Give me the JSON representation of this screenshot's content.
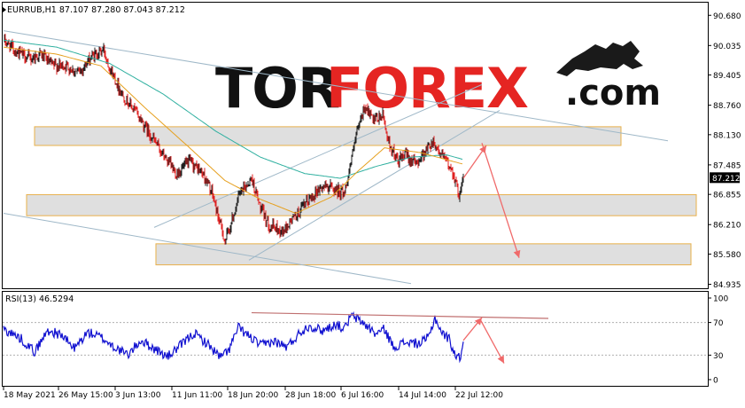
{
  "symbol_header": "EURRUB,H1  87.107 87.280 87.043 87.212",
  "watermark": {
    "part1": "TOR",
    "part2": "FOREX",
    "suffix": ".com"
  },
  "colors": {
    "bull": "#1f1f1f",
    "bear": "#e02020",
    "ma_fast": "#e6a01e",
    "ma_slow": "#30b0a0",
    "zone_fill": "#dcdcdc",
    "zone_border": "#e8b04a",
    "channel": "#9fb8c8",
    "arrow": "#f06a6a",
    "rsi": "#1010d0",
    "rsi_trend": "#c07070"
  },
  "chart_data": [
    {
      "type": "candlestick",
      "title": "EURRUB,H1",
      "ohlc_last": {
        "open": 87.107,
        "high": 87.28,
        "low": 87.043,
        "close": 87.212
      },
      "price_label": "87.212",
      "y_ticks": [
        "90.680",
        "90.035",
        "89.405",
        "88.760",
        "88.130",
        "87.485",
        "86.855",
        "86.210",
        "85.580",
        "84.935"
      ],
      "ylim": [
        84.85,
        90.95
      ],
      "x_ticks": [
        "18 May 2021",
        "26 May 15:00",
        "3 Jun 13:00",
        "11 Jun 11:00",
        "18 Jun 20:00",
        "28 Jun 18:00",
        "6 Jul 16:00",
        "14 Jul 14:00",
        "22 Jul 12:00"
      ],
      "close_anchors": [
        [
          0,
          90.15
        ],
        [
          15,
          89.9
        ],
        [
          30,
          89.75
        ],
        [
          42,
          89.85
        ],
        [
          55,
          89.6
        ],
        [
          70,
          89.6
        ],
        [
          85,
          89.45
        ],
        [
          100,
          89.8
        ],
        [
          113,
          89.95
        ],
        [
          120,
          89.55
        ],
        [
          135,
          88.95
        ],
        [
          150,
          88.6
        ],
        [
          165,
          88.15
        ],
        [
          180,
          87.7
        ],
        [
          195,
          87.3
        ],
        [
          210,
          87.55
        ],
        [
          225,
          87.3
        ],
        [
          235,
          86.9
        ],
        [
          242,
          86.4
        ],
        [
          250,
          85.85
        ],
        [
          258,
          86.3
        ],
        [
          265,
          86.8
        ],
        [
          272,
          87.0
        ],
        [
          280,
          87.2
        ],
        [
          290,
          86.55
        ],
        [
          300,
          86.2
        ],
        [
          315,
          86.05
        ],
        [
          325,
          86.3
        ],
        [
          335,
          86.5
        ],
        [
          345,
          86.75
        ],
        [
          355,
          86.95
        ],
        [
          365,
          87.05
        ],
        [
          375,
          86.95
        ],
        [
          385,
          86.9
        ],
        [
          392,
          87.55
        ],
        [
          400,
          88.25
        ],
        [
          408,
          88.75
        ],
        [
          418,
          88.4
        ],
        [
          428,
          88.55
        ],
        [
          435,
          87.95
        ],
        [
          445,
          87.55
        ],
        [
          455,
          87.7
        ],
        [
          465,
          87.5
        ],
        [
          475,
          87.75
        ],
        [
          485,
          88.0
        ],
        [
          492,
          87.75
        ],
        [
          500,
          87.55
        ],
        [
          507,
          87.35
        ],
        [
          514,
          86.85
        ],
        [
          519,
          87.2
        ]
      ],
      "ma_fast_anchors": [
        [
          0,
          90.0
        ],
        [
          60,
          89.85
        ],
        [
          110,
          89.6
        ],
        [
          160,
          88.7
        ],
        [
          210,
          87.85
        ],
        [
          250,
          87.15
        ],
        [
          290,
          86.75
        ],
        [
          330,
          86.45
        ],
        [
          370,
          86.8
        ],
        [
          400,
          87.35
        ],
        [
          430,
          87.85
        ],
        [
          470,
          87.75
        ],
        [
          519,
          87.5
        ]
      ],
      "ma_slow_anchors": [
        [
          0,
          90.15
        ],
        [
          60,
          90.0
        ],
        [
          120,
          89.65
        ],
        [
          180,
          89.0
        ],
        [
          240,
          88.2
        ],
        [
          290,
          87.65
        ],
        [
          340,
          87.3
        ],
        [
          380,
          87.2
        ],
        [
          420,
          87.45
        ],
        [
          460,
          87.65
        ],
        [
          500,
          87.7
        ],
        [
          519,
          87.6
        ]
      ],
      "zones": [
        {
          "top": 88.3,
          "bottom": 87.9,
          "x_from": 39,
          "x_to": 701
        },
        {
          "top": 86.85,
          "bottom": 86.4,
          "x_from": 30,
          "x_to": 786
        },
        {
          "top": 85.8,
          "bottom": 85.35,
          "x_from": 176,
          "x_to": 780
        }
      ],
      "channels": [
        {
          "from": [
            0,
            90.35
          ],
          "to": [
            750,
            88.0
          ]
        },
        {
          "from": [
            0,
            86.45
          ],
          "to": [
            460,
            84.95
          ]
        },
        {
          "from": [
            170,
            86.15
          ],
          "to": [
            540,
            89.2
          ]
        },
        {
          "from": [
            277,
            85.45
          ],
          "to": [
            560,
            88.65
          ]
        }
      ],
      "arrows": [
        {
          "from": [
            519,
            87.2
          ],
          "to": [
            545,
            87.9
          ]
        },
        {
          "from": [
            540,
            87.95
          ],
          "to": [
            582,
            85.5
          ]
        }
      ]
    },
    {
      "type": "line",
      "title": "RSI(13) 46.5294",
      "series": [
        {
          "name": "RSI(13)",
          "last": 46.5294
        }
      ],
      "y_ticks": [
        "100",
        "70",
        "30",
        "0"
      ],
      "ylim": [
        0,
        100
      ],
      "levels": [
        70,
        30
      ],
      "rsi_anchors": [
        [
          0,
          62
        ],
        [
          20,
          50
        ],
        [
          35,
          34
        ],
        [
          50,
          60
        ],
        [
          65,
          55
        ],
        [
          80,
          38
        ],
        [
          95,
          58
        ],
        [
          110,
          52
        ],
        [
          125,
          40
        ],
        [
          140,
          30
        ],
        [
          155,
          48
        ],
        [
          170,
          38
        ],
        [
          185,
          28
        ],
        [
          200,
          42
        ],
        [
          215,
          57
        ],
        [
          230,
          44
        ],
        [
          245,
          27
        ],
        [
          255,
          38
        ],
        [
          265,
          64
        ],
        [
          275,
          55
        ],
        [
          290,
          42
        ],
        [
          305,
          47
        ],
        [
          320,
          40
        ],
        [
          335,
          58
        ],
        [
          345,
          66
        ],
        [
          360,
          60
        ],
        [
          375,
          68
        ],
        [
          385,
          62
        ],
        [
          392,
          78
        ],
        [
          400,
          74
        ],
        [
          410,
          66
        ],
        [
          420,
          56
        ],
        [
          430,
          62
        ],
        [
          440,
          40
        ],
        [
          455,
          46
        ],
        [
          470,
          44
        ],
        [
          480,
          52
        ],
        [
          487,
          76
        ],
        [
          495,
          57
        ],
        [
          503,
          50
        ],
        [
          510,
          30
        ],
        [
          515,
          26
        ],
        [
          519,
          46
        ]
      ],
      "trendline": {
        "from": [
          280,
          82
        ],
        "to": [
          615,
          75
        ]
      },
      "arrows": [
        {
          "from": [
            519,
            48
          ],
          "to": [
            540,
            76
          ]
        },
        {
          "from": [
            538,
            74
          ],
          "to": [
            565,
            20
          ]
        }
      ]
    }
  ]
}
